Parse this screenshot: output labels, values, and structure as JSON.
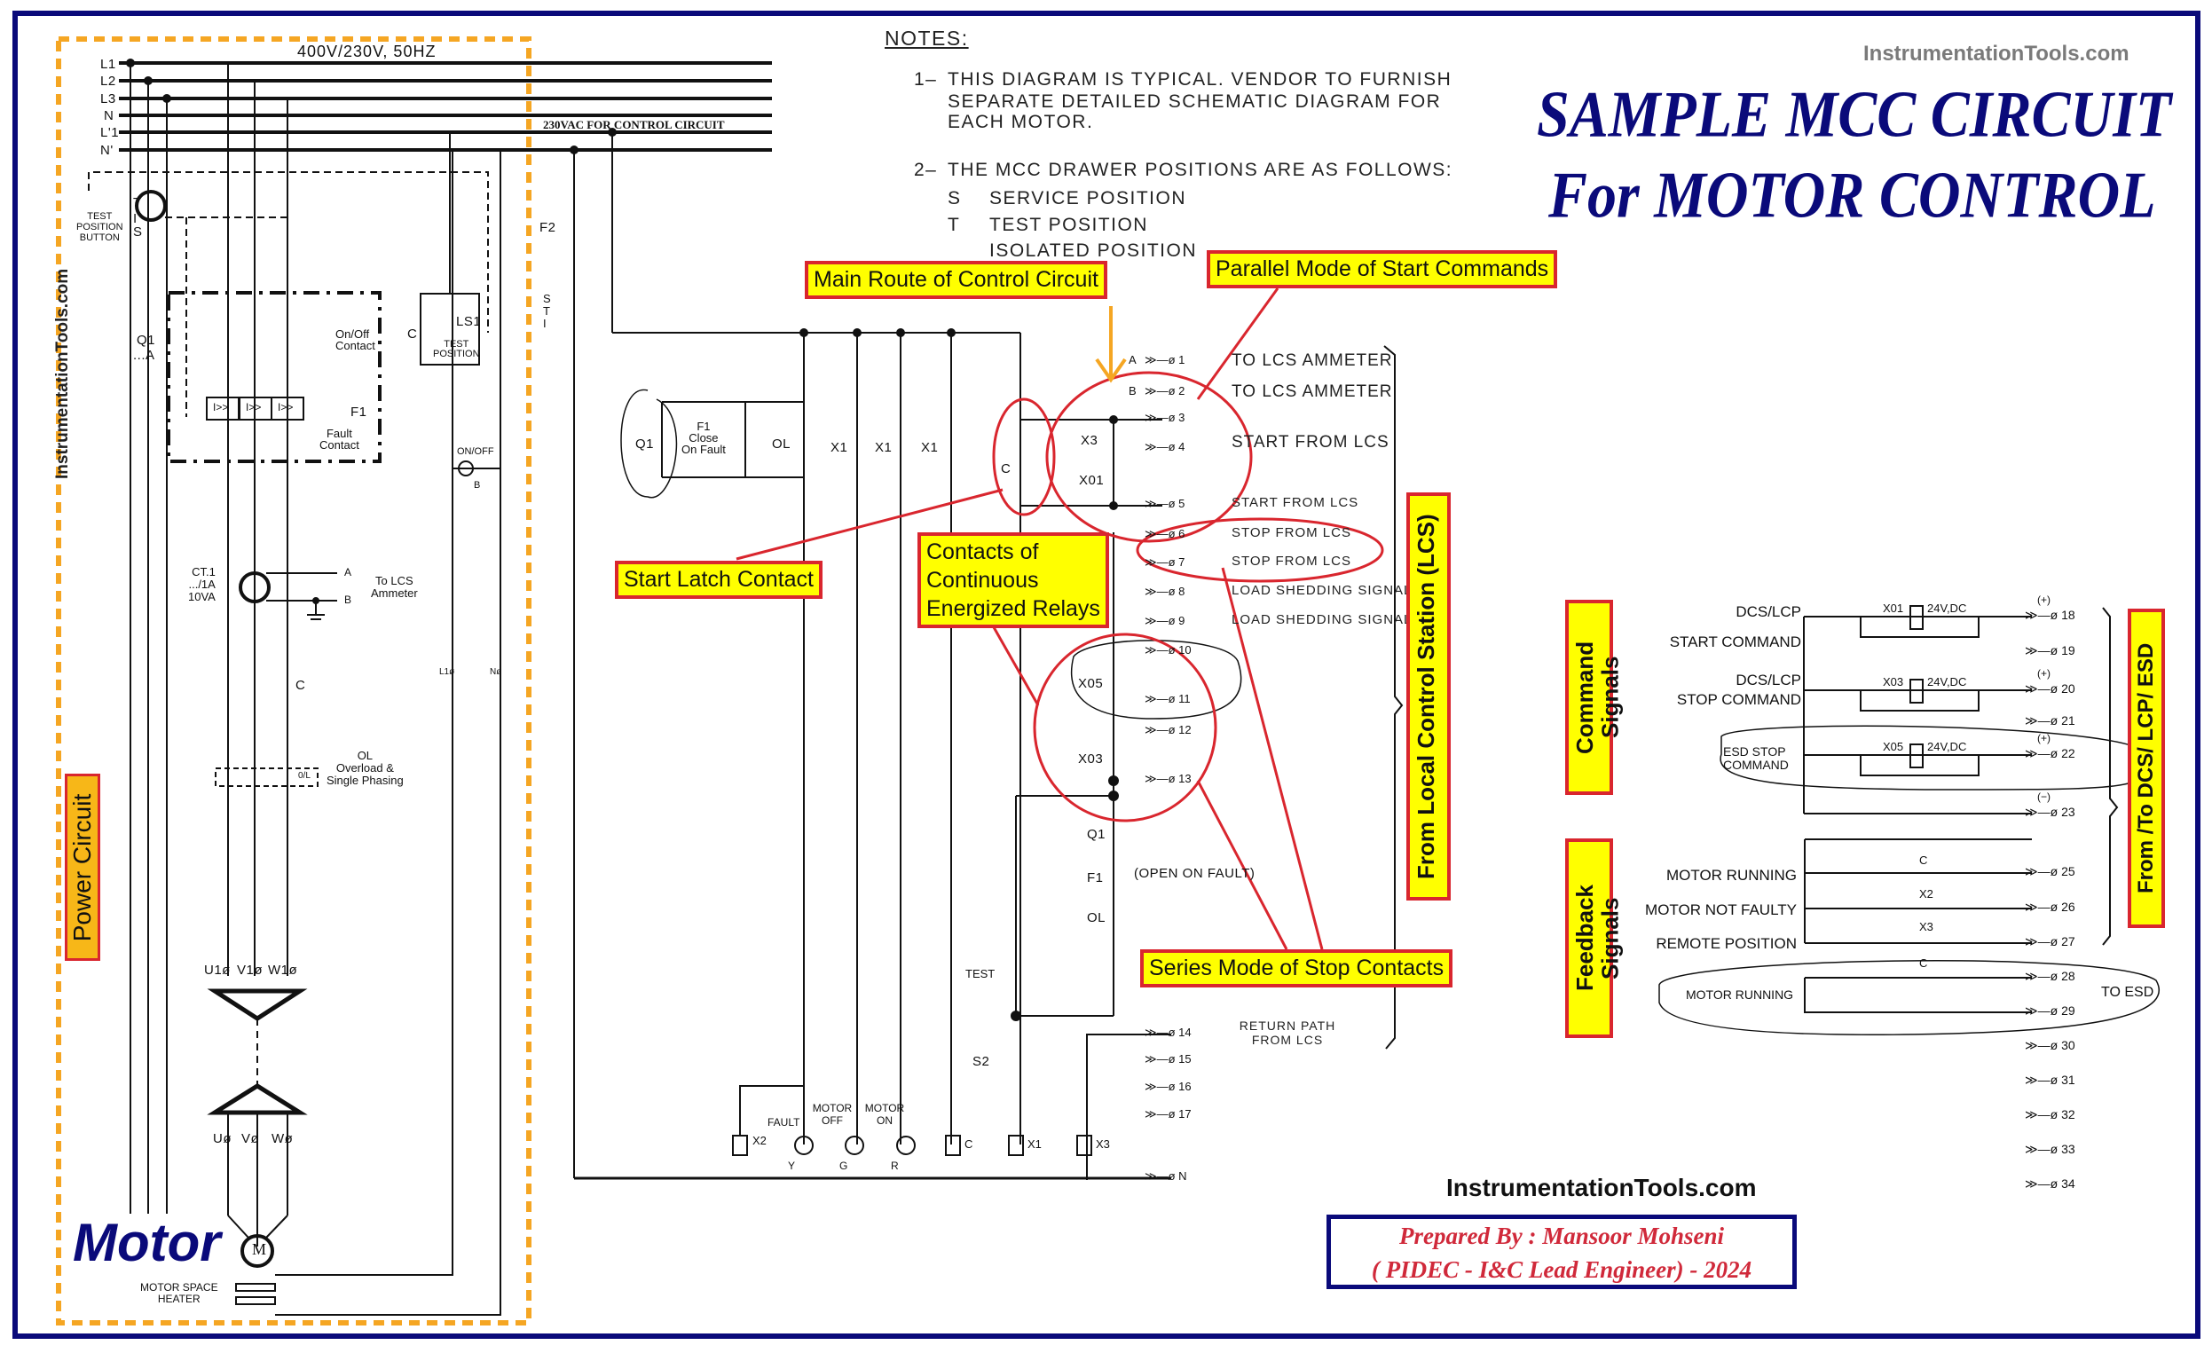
{
  "diagram": {
    "title_line1": "SAMPLE MCC CIRCUIT",
    "title_line2": "For MOTOR CONTROL",
    "brand_top": "InstrumentationTools.com",
    "brand_bottom": "InstrumentationTools.com",
    "brand_vertical": "InstrumentationTools.com",
    "prepared_by_line1": "Prepared By : Mansoor Mohseni",
    "prepared_by_line2": "( PIDEC - I&C Lead Engineer) - 2024",
    "colors": {
      "frame": "#0a0a7a",
      "callout_fill": "#ffff00",
      "callout_border": "#d9262e",
      "power_box": "#f7b718",
      "annotation_red": "#d9262e",
      "arrow_orange": "#f5a623"
    }
  },
  "notes": {
    "heading": "NOTES:",
    "items": [
      {
        "num": "1–",
        "lines": [
          "THIS DIAGRAM IS TYPICAL. VENDOR TO FURNISH",
          "SEPARATE DETAILED SCHEMATIC DIAGRAM FOR",
          "EACH MOTOR."
        ]
      },
      {
        "num": "2–",
        "lines": [
          "THE MCC DRAWER POSITIONS ARE AS FOLLOWS:"
        ]
      }
    ],
    "positions": [
      {
        "code": "S",
        "label": "SERVICE POSITION"
      },
      {
        "code": "T",
        "label": "TEST POSITION"
      },
      {
        "code": "",
        "label": "ISOLATED POSITION"
      }
    ]
  },
  "power_circuit": {
    "section_label": "Power Circuit",
    "supply_label": "400V/230V, 50HZ",
    "control_supply_label": "230VAC FOR CONTROL CIRCUIT",
    "buses": [
      "L1",
      "L2",
      "L3",
      "N",
      "L'1",
      "N'"
    ],
    "test_button": [
      "TEST",
      "POSITION",
      "BUTTON"
    ],
    "selector_positions": [
      "T",
      "I",
      "S"
    ],
    "breaker": {
      "tag": "Q1",
      "sub": "...A",
      "onoff": [
        "On/Off",
        "Contact"
      ],
      "trip": "I>>",
      "fault_tag": "F1",
      "fault": [
        "Fault",
        "Contact"
      ]
    },
    "ls1": {
      "tag": "LS1",
      "contact": "C",
      "label": [
        "TEST",
        "POSITION"
      ]
    },
    "indicator": {
      "label": "ON/OFF",
      "color": "B"
    },
    "ct": {
      "lines": [
        "CT.1",
        ".../1A",
        "10VA"
      ],
      "a": "A",
      "b": "B",
      "dest": [
        "To LCS",
        "Ammeter"
      ]
    },
    "contactor": "C",
    "overload": {
      "tag": "0/L",
      "lines": [
        "OL",
        "Overload &",
        "Single Phasing"
      ]
    },
    "terminals_top": [
      "U1ø",
      "V1ø",
      "W1ø"
    ],
    "terminals_motor": [
      "Uø",
      "Vø",
      "Wø"
    ],
    "l1_term": "L1ø",
    "n_term": "Nø",
    "motor_word": "Motor",
    "motor_symbol": "M",
    "heater": [
      "MOTOR SPACE",
      "HEATER"
    ]
  },
  "control_circuit": {
    "fuse": "F2",
    "selector": [
      "S",
      "T",
      "I"
    ],
    "q1": "Q1",
    "f1_close": [
      "F1",
      "Close",
      "On Fault"
    ],
    "ol": "OL",
    "x1": "X1",
    "c": "C",
    "x3": "X3",
    "x01": "X01",
    "x05": "X05",
    "x03": "X03",
    "series": {
      "q1": "Q1",
      "f1": "F1",
      "ol": "OL",
      "note": "(OPEN ON FAULT)"
    },
    "test": "TEST",
    "s2": "S2",
    "loads": [
      {
        "tag": "X2",
        "type": "relay"
      },
      {
        "tag": "FAULT",
        "color": "Y",
        "type": "lamp"
      },
      {
        "tag": "MOTOR OFF",
        "color": "G",
        "type": "lamp"
      },
      {
        "tag": "MOTOR ON",
        "color": "R",
        "type": "lamp"
      },
      {
        "tag": "C",
        "type": "coil"
      },
      {
        "tag": "X1",
        "type": "relay"
      },
      {
        "tag": "X3",
        "type": "relay"
      }
    ]
  },
  "lcs_terminals": {
    "group_label": "From Local Control Station (LCS)",
    "items": [
      {
        "num": "1",
        "prefix": "A",
        "label": "TO LCS AMMETER"
      },
      {
        "num": "2",
        "prefix": "B",
        "label": "TO LCS AMMETER"
      },
      {
        "num": "3",
        "label": ""
      },
      {
        "num": "4",
        "label": "START FROM LCS"
      },
      {
        "num": "5",
        "label": "START FROM LCS"
      },
      {
        "num": "6",
        "label": "STOP FROM LCS"
      },
      {
        "num": "7",
        "label": "STOP FROM LCS"
      },
      {
        "num": "8",
        "label": "LOAD SHEDDING SIGNAL"
      },
      {
        "num": "9",
        "label": "LOAD SHEDDING SIGNAL"
      },
      {
        "num": "10",
        "label": ""
      },
      {
        "num": "11",
        "label": ""
      },
      {
        "num": "12",
        "label": ""
      },
      {
        "num": "13",
        "label": ""
      },
      {
        "num": "14",
        "label": "RETURN PATH FROM LCS"
      },
      {
        "num": "15",
        "label": ""
      },
      {
        "num": "16",
        "label": ""
      },
      {
        "num": "17",
        "label": ""
      },
      {
        "num": "N",
        "label": ""
      }
    ]
  },
  "dcs_terminals": {
    "group_label": "From /To DCS/ LCP/ ESD",
    "command_label": "Command Signals",
    "feedback_label": "Feedback Signals",
    "commands": [
      {
        "label": [
          "DCS/LCP",
          "START COMMAND"
        ],
        "relay": "X01",
        "supply": "24V,DC",
        "term": "18",
        "pol": "(+)"
      },
      {
        "label": [
          "DCS/LCP",
          "STOP COMMAND"
        ],
        "relay": "X03",
        "supply": "24V,DC",
        "term": "20",
        "pol": "(+)"
      },
      {
        "label": [
          "ESD STOP",
          "COMMAND"
        ],
        "relay": "X05",
        "supply": "24V,DC",
        "term": "22",
        "pol": "(+)"
      }
    ],
    "spare_terms": [
      "19",
      "21"
    ],
    "neg_term": {
      "num": "23",
      "pol": "(−)"
    },
    "feedbacks": [
      {
        "label": "MOTOR RUNNING",
        "contact": "C",
        "term": "25"
      },
      {
        "label": "MOTOR NOT FAULTY",
        "contact": "X2",
        "term": "26"
      },
      {
        "label": "REMOTE POSITION",
        "contact": "X3",
        "term": "27"
      }
    ],
    "esd_feedback": {
      "label": "MOTOR RUNNING",
      "contact": "C",
      "terms": [
        "28",
        "29"
      ],
      "dest": "TO ESD"
    },
    "extra_terms": [
      "30",
      "31",
      "32",
      "33",
      "34"
    ]
  },
  "callouts": {
    "main_route": "Main Route of Control Circuit",
    "parallel": "Parallel Mode of Start Commands",
    "start_latch": "Start Latch Contact",
    "continuous": [
      "Contacts of",
      "Continuous",
      "Energized Relays"
    ],
    "series_stop": "Series Mode of Stop Contacts"
  }
}
